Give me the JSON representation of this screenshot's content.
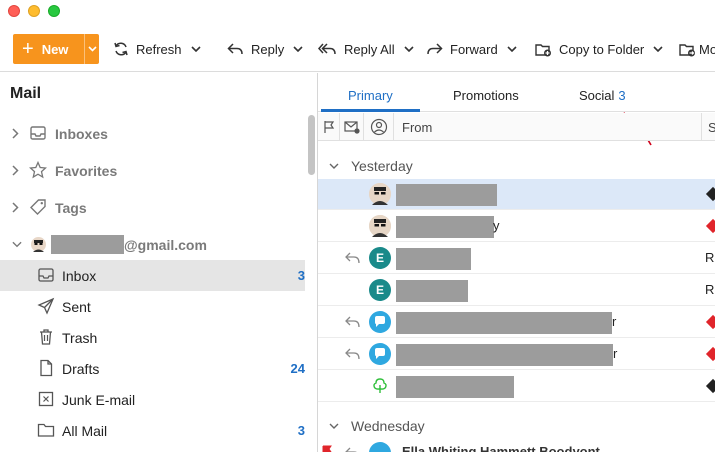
{
  "window": {
    "controls": [
      "close",
      "minimize",
      "zoom"
    ]
  },
  "toolbar": {
    "new_label": "New",
    "refresh_label": "Refresh",
    "reply_label": "Reply",
    "reply_all_label": "Reply All",
    "forward_label": "Forward",
    "copy_to_folder_label": "Copy to Folder",
    "move_label": "Mo",
    "accent_color": "#f7941d"
  },
  "sidebar": {
    "title": "Mail",
    "groups": [
      {
        "label": "Inboxes",
        "icon": "inbox-tray-icon"
      },
      {
        "label": "Favorites",
        "icon": "star-icon"
      },
      {
        "label": "Tags",
        "icon": "tag-icon"
      }
    ],
    "account": {
      "email_suffix": "@gmail.com"
    },
    "folders": [
      {
        "label": "Inbox",
        "count": "3",
        "icon": "inbox-tray-icon",
        "selected": true
      },
      {
        "label": "Sent",
        "count": "",
        "icon": "paper-plane-icon"
      },
      {
        "label": "Trash",
        "count": "",
        "icon": "trash-icon"
      },
      {
        "label": "Drafts",
        "count": "24",
        "icon": "document-icon"
      },
      {
        "label": "Junk E-mail",
        "count": "",
        "icon": "junk-box-icon"
      },
      {
        "label": "All Mail",
        "count": "3",
        "icon": "folder-icon"
      }
    ]
  },
  "tabs": [
    {
      "label": "Primary",
      "active": true
    },
    {
      "label": "Promotions",
      "active": false
    },
    {
      "label": "Social",
      "badge": "3",
      "active": false
    }
  ],
  "columns": {
    "from_label": "From",
    "subject_label": "S"
  },
  "message_groups": [
    {
      "label": "Yesterday"
    },
    {
      "label": "Wednesday"
    }
  ],
  "messages": [
    {
      "avatar": "photo",
      "trail": "",
      "subject_initial": "",
      "tag_color": "#222222",
      "replied": false,
      "selected": true
    },
    {
      "avatar": "photo",
      "trail": "y",
      "subject_initial": "",
      "tag_color": "#e0252b",
      "replied": false
    },
    {
      "avatar": "E",
      "avatar_color": "#1a8a8a",
      "trail": "",
      "subject_initial": "R",
      "replied": true
    },
    {
      "avatar": "E",
      "avatar_color": "#1a8a8a",
      "trail": "",
      "subject_initial": "R",
      "replied": false
    },
    {
      "avatar": "chat",
      "avatar_color": "#2fa8e0",
      "trail": "r",
      "subject_initial": "",
      "tag_color": "#e0252b",
      "replied": true
    },
    {
      "avatar": "chat",
      "avatar_color": "#2fa8e0",
      "trail": "r",
      "subject_initial": "",
      "tag_color": "#e0252b",
      "replied": true
    },
    {
      "avatar": "tree",
      "avatar_color": "#2fbf3a",
      "trail": "",
      "subject_initial": "",
      "tag_color": "#222222",
      "replied": false
    }
  ],
  "partial_row": {
    "text": "Ella Whiting Hammett Boodyont"
  }
}
